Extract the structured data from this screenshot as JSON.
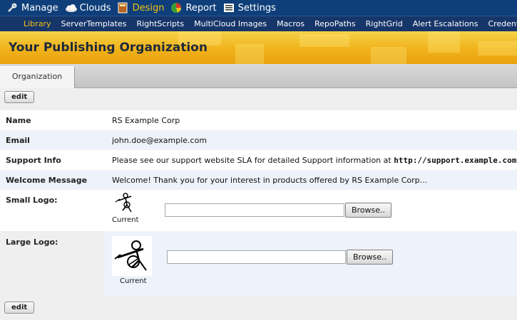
{
  "top_nav": {
    "items": [
      {
        "label": "Manage",
        "icon": "wrench-icon"
      },
      {
        "label": "Clouds",
        "icon": "cloud-icon"
      },
      {
        "label": "Design",
        "icon": "book-icon",
        "active": true
      },
      {
        "label": "Report",
        "icon": "pie-chart-icon"
      },
      {
        "label": "Settings",
        "icon": "settings-list-icon"
      }
    ]
  },
  "sub_nav": {
    "items": [
      "Library",
      "ServerTemplates",
      "RightScripts",
      "MultiCloud Images",
      "Macros",
      "RepoPaths",
      "RightGrid",
      "Alert Escalations",
      "Credentials"
    ],
    "active": "Library"
  },
  "banner": {
    "title": "Your Publishing Organization"
  },
  "tabs": [
    {
      "label": "Organization"
    }
  ],
  "buttons": {
    "edit_top": "edit",
    "edit_bottom": "edit",
    "browse": "Browse.."
  },
  "fields": {
    "name": {
      "label": "Name",
      "value": "RS Example Corp"
    },
    "email": {
      "label": "Email",
      "value": "john.doe@example.com"
    },
    "support": {
      "label": "Support Info",
      "value": "Please see our support website SLA for detailed Support information at ",
      "url": "http://support.example.com/sla"
    },
    "welcome": {
      "label": "Welcome Message",
      "value": "Welcome! Thank you for your interest in products offered by RS Example Corp..."
    },
    "small_logo": {
      "label": "Small Logo:",
      "caption": "Current",
      "file_value": ""
    },
    "large_logo": {
      "label": "Large Logo:",
      "caption": "Current",
      "file_value": ""
    }
  },
  "colors": {
    "nav_bg": "#0f3f7a",
    "subnav_bg": "#16366a",
    "active_nav": "#f5c116",
    "banner": "#f0b21a",
    "row_alt": "#eef2fa"
  }
}
